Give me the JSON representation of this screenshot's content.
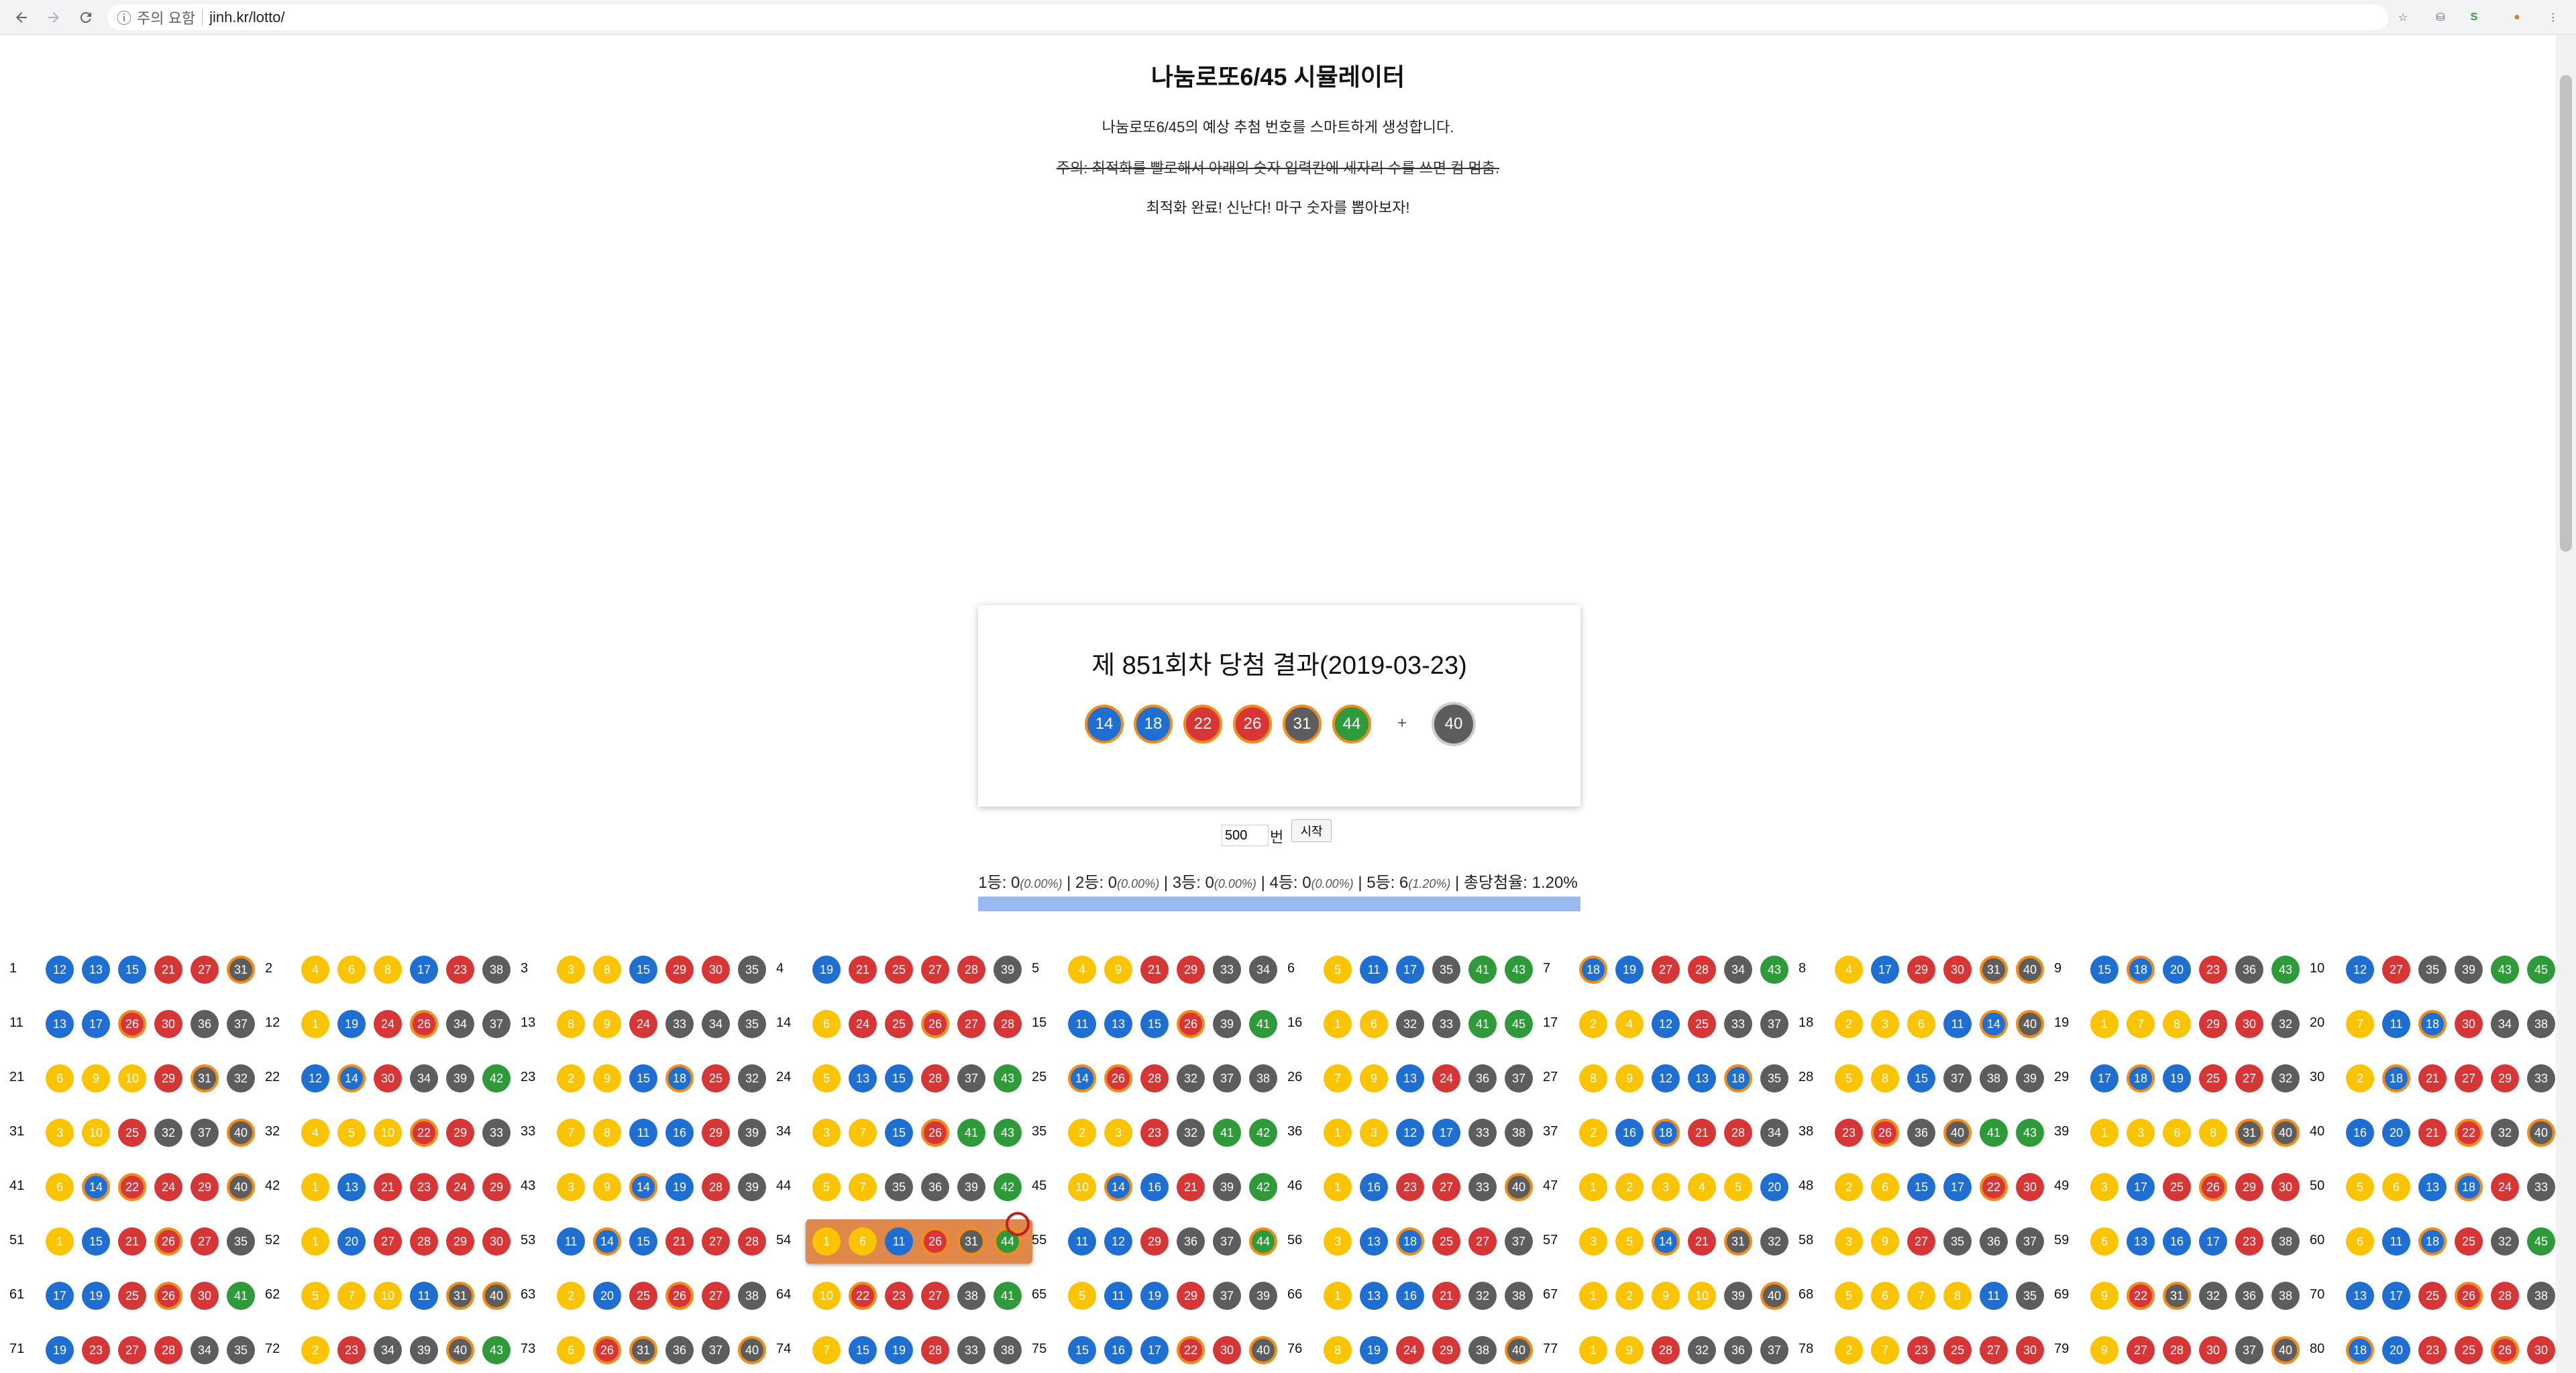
{
  "browser": {
    "security_label": "주의 요함",
    "url": "jinh.kr/lotto/"
  },
  "page": {
    "title": "나눔로또6/45 시뮬레이터",
    "subtitle": "나눔로또6/45의 예상 추첨 번호를 스마트하게 생성합니다.",
    "warning": "주의: 최적화를 빨로해서 아래의 숫자 입력칸에 세자리 수를 쓰면 컴 멈춤.",
    "done": "최적화 완료! 신난다! 마구 숫자를 뽑아보자!"
  },
  "result": {
    "title": "제 851회차 당첨 결과(2019-03-23)",
    "numbers": [
      14,
      18,
      22,
      26,
      31,
      44
    ],
    "plus": "+",
    "bonus": 40
  },
  "controls": {
    "count": "500",
    "unit": "번",
    "start": "시작"
  },
  "stats": {
    "r1": "1등: 0",
    "p1": "(0.00%)",
    "r2": "2등: 0",
    "p2": "(0.00%)",
    "r3": "3등: 0",
    "p3": "(0.00%)",
    "r4": "4등: 0",
    "p4": "(0.00%)",
    "r5": "5등: 6",
    "p5": "(1.20%)",
    "total": "총당첨율: 1.20%",
    "sep": " | "
  },
  "colors": {
    "yellow": "#fbc400",
    "blue": "#1e6fd1",
    "red": "#d63636",
    "gray": "#5d5d5d",
    "green": "#2e9a3a",
    "hit_ring": "#f28c1a",
    "highlight": "#e0884a"
  },
  "highlighted_draw": 54,
  "draws": [
    [
      1,
      [
        12,
        13,
        15,
        21,
        27,
        31
      ]
    ],
    [
      2,
      [
        4,
        6,
        8,
        17,
        23,
        38
      ]
    ],
    [
      3,
      [
        3,
        8,
        15,
        29,
        30,
        35
      ]
    ],
    [
      4,
      [
        19,
        21,
        25,
        27,
        28,
        39
      ]
    ],
    [
      5,
      [
        4,
        9,
        21,
        29,
        33,
        34
      ]
    ],
    [
      6,
      [
        5,
        11,
        17,
        35,
        41,
        43
      ]
    ],
    [
      7,
      [
        18,
        19,
        27,
        28,
        34,
        43
      ]
    ],
    [
      8,
      [
        4,
        17,
        29,
        30,
        31,
        40
      ]
    ],
    [
      9,
      [
        15,
        18,
        20,
        23,
        36,
        43
      ]
    ],
    [
      10,
      [
        12,
        27,
        35,
        39,
        43,
        45
      ]
    ],
    [
      11,
      [
        13,
        17,
        26,
        30,
        36,
        37
      ]
    ],
    [
      12,
      [
        1,
        19,
        24,
        26,
        34,
        37
      ]
    ],
    [
      13,
      [
        8,
        9,
        24,
        33,
        34,
        35
      ]
    ],
    [
      14,
      [
        6,
        24,
        25,
        26,
        27,
        28
      ]
    ],
    [
      15,
      [
        11,
        13,
        15,
        26,
        39,
        41
      ]
    ],
    [
      16,
      [
        1,
        6,
        32,
        33,
        41,
        45
      ]
    ],
    [
      17,
      [
        2,
        4,
        12,
        25,
        33,
        37
      ]
    ],
    [
      18,
      [
        2,
        3,
        6,
        11,
        14,
        40
      ]
    ],
    [
      19,
      [
        1,
        7,
        8,
        29,
        30,
        32
      ]
    ],
    [
      20,
      [
        7,
        11,
        18,
        30,
        34,
        38
      ]
    ],
    [
      21,
      [
        6,
        9,
        10,
        29,
        31,
        32
      ]
    ],
    [
      22,
      [
        12,
        14,
        30,
        34,
        39,
        42
      ]
    ],
    [
      23,
      [
        2,
        9,
        15,
        18,
        25,
        32
      ]
    ],
    [
      24,
      [
        5,
        13,
        15,
        28,
        37,
        43
      ]
    ],
    [
      25,
      [
        14,
        26,
        28,
        32,
        37,
        38
      ]
    ],
    [
      26,
      [
        7,
        9,
        13,
        24,
        36,
        37
      ]
    ],
    [
      27,
      [
        8,
        9,
        12,
        13,
        18,
        35
      ]
    ],
    [
      28,
      [
        5,
        8,
        15,
        37,
        38,
        39
      ]
    ],
    [
      29,
      [
        17,
        18,
        19,
        25,
        27,
        32
      ]
    ],
    [
      30,
      [
        2,
        18,
        21,
        27,
        29,
        33
      ]
    ],
    [
      31,
      [
        3,
        10,
        25,
        32,
        37,
        40
      ]
    ],
    [
      32,
      [
        4,
        5,
        10,
        22,
        29,
        33
      ]
    ],
    [
      33,
      [
        7,
        8,
        11,
        16,
        29,
        39
      ]
    ],
    [
      34,
      [
        3,
        7,
        15,
        26,
        41,
        43
      ]
    ],
    [
      35,
      [
        2,
        3,
        23,
        32,
        41,
        42
      ]
    ],
    [
      36,
      [
        1,
        3,
        12,
        17,
        33,
        38
      ]
    ],
    [
      37,
      [
        2,
        16,
        18,
        21,
        28,
        34
      ]
    ],
    [
      38,
      [
        23,
        26,
        36,
        40,
        41,
        43
      ]
    ],
    [
      39,
      [
        1,
        3,
        6,
        8,
        31,
        40
      ]
    ],
    [
      40,
      [
        16,
        20,
        21,
        22,
        32,
        40
      ]
    ],
    [
      41,
      [
        6,
        14,
        22,
        24,
        29,
        40
      ]
    ],
    [
      42,
      [
        1,
        13,
        21,
        23,
        24,
        29
      ]
    ],
    [
      43,
      [
        3,
        9,
        14,
        19,
        28,
        39
      ]
    ],
    [
      44,
      [
        5,
        7,
        35,
        36,
        39,
        42
      ]
    ],
    [
      45,
      [
        10,
        14,
        16,
        21,
        39,
        42
      ]
    ],
    [
      46,
      [
        1,
        16,
        23,
        27,
        33,
        40
      ]
    ],
    [
      47,
      [
        1,
        2,
        3,
        4,
        5,
        20
      ]
    ],
    [
      48,
      [
        2,
        6,
        15,
        17,
        22,
        30
      ]
    ],
    [
      49,
      [
        3,
        17,
        25,
        26,
        29,
        30
      ]
    ],
    [
      50,
      [
        5,
        6,
        13,
        18,
        24,
        33
      ]
    ],
    [
      51,
      [
        1,
        15,
        21,
        26,
        27,
        35
      ]
    ],
    [
      52,
      [
        1,
        20,
        27,
        28,
        29,
        30
      ]
    ],
    [
      53,
      [
        11,
        14,
        15,
        21,
        27,
        28
      ]
    ],
    [
      54,
      [
        1,
        6,
        11,
        26,
        31,
        44
      ]
    ],
    [
      55,
      [
        11,
        12,
        29,
        36,
        37,
        44
      ]
    ],
    [
      56,
      [
        3,
        13,
        18,
        25,
        27,
        37
      ]
    ],
    [
      57,
      [
        3,
        5,
        14,
        21,
        31,
        32
      ]
    ],
    [
      58,
      [
        3,
        9,
        27,
        35,
        36,
        37
      ]
    ],
    [
      59,
      [
        6,
        13,
        16,
        17,
        23,
        38
      ]
    ],
    [
      60,
      [
        6,
        11,
        18,
        25,
        32,
        45
      ]
    ],
    [
      61,
      [
        17,
        19,
        25,
        26,
        30,
        41
      ]
    ],
    [
      62,
      [
        5,
        7,
        10,
        11,
        31,
        40
      ]
    ],
    [
      63,
      [
        2,
        20,
        25,
        26,
        27,
        38
      ]
    ],
    [
      64,
      [
        10,
        22,
        23,
        27,
        38,
        41
      ]
    ],
    [
      65,
      [
        5,
        11,
        19,
        29,
        37,
        39
      ]
    ],
    [
      66,
      [
        1,
        13,
        16,
        21,
        32,
        38
      ]
    ],
    [
      67,
      [
        1,
        2,
        9,
        10,
        39,
        40
      ]
    ],
    [
      68,
      [
        5,
        6,
        7,
        8,
        11,
        35
      ]
    ],
    [
      69,
      [
        9,
        22,
        31,
        32,
        36,
        38
      ]
    ],
    [
      70,
      [
        13,
        17,
        25,
        26,
        28,
        38
      ]
    ],
    [
      71,
      [
        19,
        23,
        27,
        28,
        34,
        35
      ]
    ],
    [
      72,
      [
        2,
        23,
        34,
        39,
        40,
        43
      ]
    ],
    [
      73,
      [
        6,
        26,
        31,
        36,
        37,
        40
      ]
    ],
    [
      74,
      [
        7,
        15,
        19,
        28,
        33,
        38
      ]
    ],
    [
      75,
      [
        15,
        16,
        17,
        22,
        30,
        40
      ]
    ],
    [
      76,
      [
        8,
        19,
        24,
        29,
        38,
        40
      ]
    ],
    [
      77,
      [
        1,
        9,
        28,
        32,
        36,
        37
      ]
    ],
    [
      78,
      [
        2,
        7,
        23,
        25,
        27,
        30
      ]
    ],
    [
      79,
      [
        9,
        27,
        28,
        30,
        37,
        40
      ]
    ],
    [
      80,
      [
        18,
        20,
        23,
        25,
        26,
        30
      ]
    ]
  ]
}
